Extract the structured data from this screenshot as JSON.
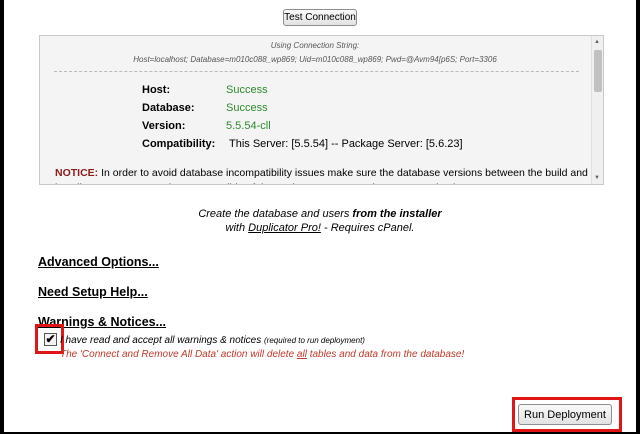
{
  "toolbar": {
    "test_connection_label": "Test Connection"
  },
  "results": {
    "connection_label": "Using Connection String:",
    "connection_string": "Host=localhost; Database=m010c088_wp869; Uid=m010c088_wp869; Pwd=@Avm94[p6S; Port=3306",
    "rows": [
      {
        "label": "Host:",
        "value": "Success"
      },
      {
        "label": "Database:",
        "value": "Success"
      },
      {
        "label": "Version:",
        "value": "5.5.54-cll"
      }
    ],
    "compat_label": "Compatibility:",
    "compat_value": "This Server: [5.5.54] -- Package Server: [5.6.23]",
    "notice_label": "NOTICE:",
    "notice_text": "In order to avoid database incompatibility issues make sure the database versions between the build and installer servers are as close as possible. If the package was created on a newer database"
  },
  "create_note": {
    "line1_prefix": "Create the database and users ",
    "line1_bold": "from the installer",
    "line2_prefix": "with ",
    "line2_link": "Duplicator Pro!",
    "line2_suffix": " - Requires cPanel."
  },
  "sections": {
    "advanced": "Advanced Options...",
    "help": "Need Setup Help...",
    "warnings": "Warnings & Notices..."
  },
  "accept": {
    "text": "I have read and accept all warnings & notices",
    "small": "(required to run deployment)",
    "checked": "✔"
  },
  "warning": {
    "prefix": "The 'Connect and Remove All Data' action will delete ",
    "emph": "all",
    "suffix": " tables and data from the database!"
  },
  "footer": {
    "run_label": "Run Deployment"
  },
  "colors": {
    "success": "#2c8a2c",
    "warning": "#c0392b",
    "highlight": "#e01515"
  }
}
